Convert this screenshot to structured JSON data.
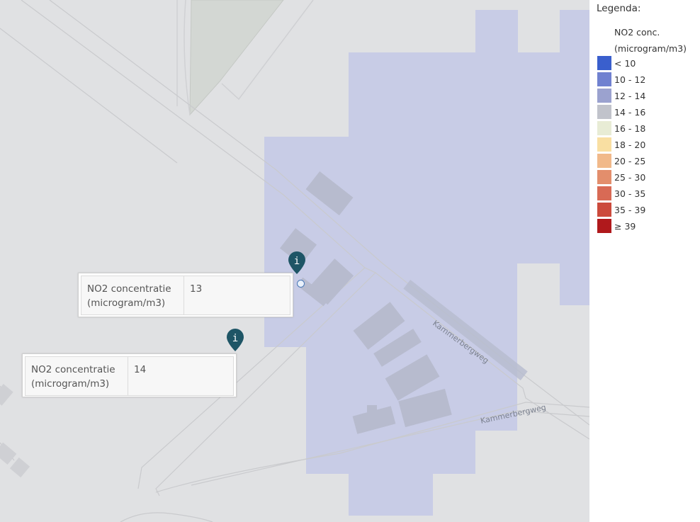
{
  "map": {
    "road_labels": [
      "Kammerbergweg",
      "Kammerbergweg"
    ],
    "popups": [
      {
        "label": "NO2 concentratie (microgram/m3)",
        "value": "13"
      },
      {
        "label": "NO2 concentratie (microgram/m3)",
        "value": "14"
      }
    ],
    "markers": [
      {
        "icon": "info-marker-icon",
        "color": "#1e5566"
      },
      {
        "icon": "info-marker-icon",
        "color": "#1e5566"
      }
    ],
    "overlay_color": "#c8cce6"
  },
  "legend": {
    "title": "Legenda:",
    "subtitle_line1": "NO2 conc.",
    "subtitle_line2": "(microgram/m3)",
    "items": [
      {
        "label": "< 10",
        "color": "#3a5fcd"
      },
      {
        "label": "10 - 12",
        "color": "#7081d0"
      },
      {
        "label": "12 - 14",
        "color": "#9ba2cf"
      },
      {
        "label": "14 - 16",
        "color": "#c1c3cb"
      },
      {
        "label": "16 - 18",
        "color": "#e8ecd5"
      },
      {
        "label": "18 - 20",
        "color": "#f9dfa2"
      },
      {
        "label": "20 - 25",
        "color": "#f1b98a"
      },
      {
        "label": "25 - 30",
        "color": "#e38e6c"
      },
      {
        "label": "30 - 35",
        "color": "#d86a55"
      },
      {
        "label": "35 - 39",
        "color": "#cc4a3c"
      },
      {
        "label": "≥ 39",
        "color": "#b0191c"
      }
    ]
  }
}
